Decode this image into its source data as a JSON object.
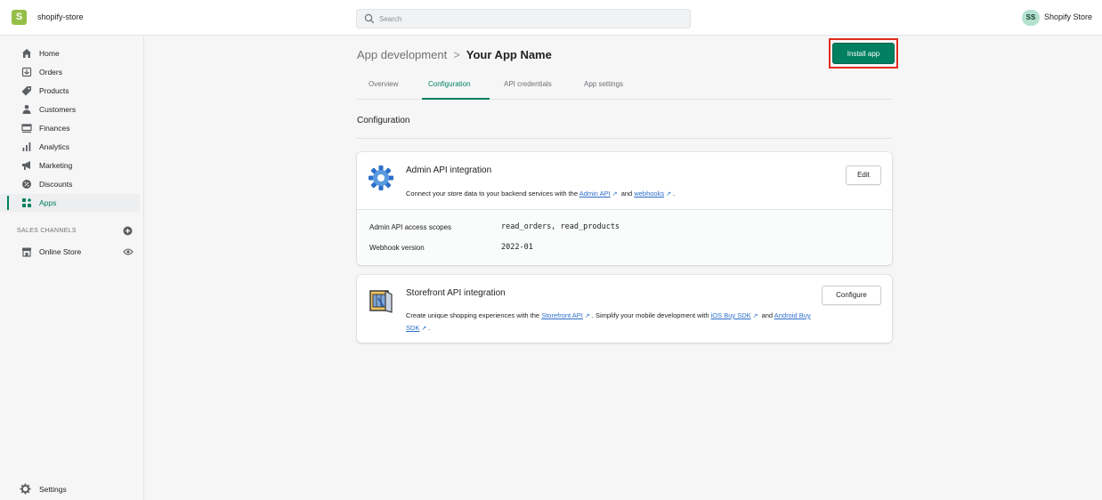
{
  "topbar": {
    "store_name": "shopify-store",
    "store_logo_letter": "S",
    "search_placeholder": "Search",
    "avatar_initials": "SS",
    "user_name": "Shopify Store"
  },
  "sidebar": {
    "items": [
      {
        "label": "Home",
        "icon": "home-icon"
      },
      {
        "label": "Orders",
        "icon": "orders-icon"
      },
      {
        "label": "Products",
        "icon": "tag-icon"
      },
      {
        "label": "Customers",
        "icon": "person-icon"
      },
      {
        "label": "Finances",
        "icon": "finances-icon"
      },
      {
        "label": "Analytics",
        "icon": "bar-chart-icon"
      },
      {
        "label": "Marketing",
        "icon": "megaphone-icon"
      },
      {
        "label": "Discounts",
        "icon": "discount-icon"
      },
      {
        "label": "Apps",
        "icon": "apps-icon",
        "active": true
      }
    ],
    "channels_heading": "SALES CHANNELS",
    "channels": [
      {
        "label": "Online Store",
        "icon": "store-icon"
      }
    ],
    "settings_label": "Settings"
  },
  "main": {
    "breadcrumb_parent": "App development",
    "breadcrumb_separator": ">",
    "breadcrumb_current": "Your App Name",
    "install_label": "Install app",
    "tabs": [
      {
        "label": "Overview"
      },
      {
        "label": "Configuration",
        "active": true
      },
      {
        "label": "API credentials"
      },
      {
        "label": "App settings"
      }
    ],
    "section_title": "Configuration",
    "admin_card": {
      "title": "Admin API integration",
      "desc_prefix": "Connect your store data to your backend services with the",
      "link1": "Admin API",
      "desc_and": "and",
      "link2": "webhooks",
      "desc_suffix": ".",
      "button_label": "Edit",
      "rows": [
        {
          "label": "Admin API access scopes",
          "value": "read_orders, read_products"
        },
        {
          "label": "Webhook version",
          "value": "2022-01"
        }
      ]
    },
    "storefront_card": {
      "title": "Storefront API integration",
      "desc_prefix": "Create unique shopping experiences with the",
      "link1": "Storefront API",
      "desc_mid": ". Simplify your mobile development with",
      "link2": "iOS Buy SDK",
      "desc_and": "and",
      "link3": "Android Buy SDK",
      "desc_suffix": ".",
      "button_label": "Configure"
    }
  },
  "colors": {
    "accent": "#008060",
    "highlight": "#e32b1b",
    "link": "#2c6ecb"
  }
}
